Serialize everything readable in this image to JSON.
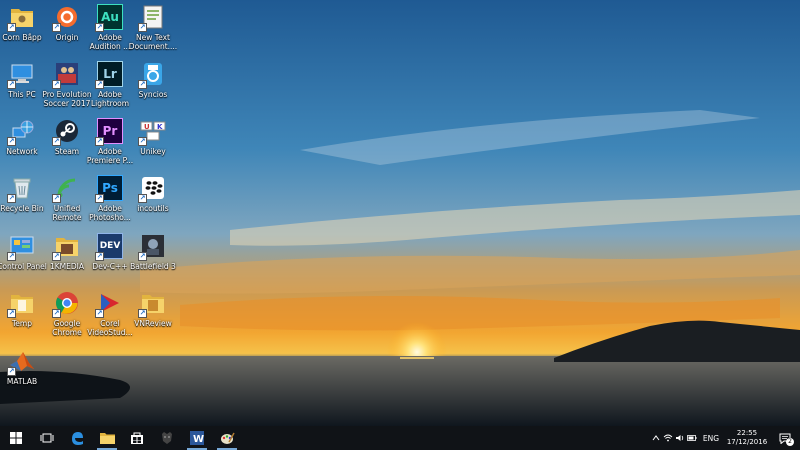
{
  "desktop": {
    "icons": [
      {
        "label": "Corn Bắpp",
        "icon": "folder-user-icon"
      },
      {
        "label": "Origin",
        "icon": "origin-icon"
      },
      {
        "label": "Adobe Audition ...",
        "icon": "adobe-audition-icon",
        "glyph": "Au"
      },
      {
        "label": "New Text Document....",
        "icon": "notepad-icon"
      },
      {
        "label": "This PC",
        "icon": "computer-icon"
      },
      {
        "label": "Pro Evolution Soccer 2017",
        "icon": "pes-game-icon"
      },
      {
        "label": "Adobe Lightroom",
        "icon": "adobe-lightroom-icon",
        "glyph": "Lr"
      },
      {
        "label": "Syncios",
        "icon": "syncios-icon"
      },
      {
        "label": "Network",
        "icon": "network-icon"
      },
      {
        "label": "Steam",
        "icon": "steam-icon"
      },
      {
        "label": "Adobe Premiere P...",
        "icon": "adobe-premiere-icon",
        "glyph": "Pr"
      },
      {
        "label": "Unikey",
        "icon": "unikey-icon"
      },
      {
        "label": "Recycle Bin",
        "icon": "recycle-bin-icon"
      },
      {
        "label": "Unified Remote",
        "icon": "unified-remote-icon"
      },
      {
        "label": "Adobe Photosho...",
        "icon": "adobe-photoshop-icon",
        "glyph": "Ps"
      },
      {
        "label": "incoutils",
        "icon": "blackberry-icon"
      },
      {
        "label": "Control Panel",
        "icon": "control-panel-icon"
      },
      {
        "label": "1KMEDIA",
        "icon": "folder-media-icon"
      },
      {
        "label": "Dev-C++",
        "icon": "dev-cpp-icon",
        "glyph": "DEV"
      },
      {
        "label": "Battlefield 3",
        "icon": "battlefield-icon"
      },
      {
        "label": "Temp",
        "icon": "folder-temp-icon"
      },
      {
        "label": "Google Chrome",
        "icon": "chrome-icon"
      },
      {
        "label": "Corel VideoStud...",
        "icon": "corel-videostudio-icon"
      },
      {
        "label": "VNReview",
        "icon": "folder-vnreview-icon"
      },
      {
        "label": "MATLAB",
        "icon": "matlab-icon"
      }
    ]
  },
  "taskbar": {
    "pinned": [
      {
        "icon": "start-windows-icon",
        "active": false
      },
      {
        "icon": "task-view-icon",
        "active": false
      },
      {
        "icon": "edge-icon",
        "active": false
      },
      {
        "icon": "file-explorer-icon",
        "active": true
      },
      {
        "icon": "store-icon",
        "active": false
      },
      {
        "icon": "game-icon",
        "active": false
      },
      {
        "icon": "word-icon",
        "active": true
      },
      {
        "icon": "paint-icon",
        "active": true
      }
    ],
    "tray": {
      "language": "ENG",
      "time": "22:55",
      "date": "17/12/2016",
      "notification_count": "2"
    }
  },
  "colors": {
    "taskbar": "#101317",
    "accent": "#76a8d6"
  }
}
